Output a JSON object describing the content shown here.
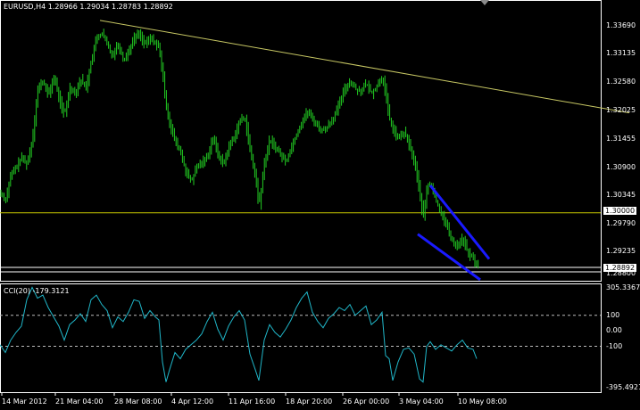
{
  "header": {
    "symbol": "EURUSD,H4",
    "open": "1.28966",
    "high": "1.29034",
    "low": "1.28783",
    "close": "1.28892"
  },
  "colors": {
    "background": "#000000",
    "candle": "#22cc22",
    "trendline": "#c8c864",
    "hline": "#c8c800",
    "wedge": "#1a1aff",
    "cci_line": "#20b6c8",
    "grid": "#ffffff"
  },
  "price_axis": {
    "ticks": [
      "1.33690",
      "1.33135",
      "1.32580",
      "1.32025",
      "1.31455",
      "1.30900",
      "1.30345",
      "1.29790",
      "1.29235",
      "1.28800"
    ],
    "tick_values": [
      1.3369,
      1.33135,
      1.3258,
      1.32025,
      1.31455,
      1.309,
      1.30345,
      1.2979,
      1.29235,
      1.288
    ],
    "hline_label": "1.30000",
    "current_label": "1.28892"
  },
  "cci": {
    "title": "CCI(20) -179.3121",
    "ticks": [
      "305.3367",
      "100",
      "0.00",
      "-100",
      "-395.4921"
    ],
    "tick_values": [
      305.3367,
      100,
      0,
      -100,
      -395.4921
    ]
  },
  "time_axis": {
    "labels": [
      "14 Mar 2012",
      "21 Mar 04:00",
      "28 Mar 08:00",
      "4 Apr 12:00",
      "11 Apr 16:00",
      "18 Apr 20:00",
      "26 Apr 00:00",
      "3 May 04:00",
      "10 May 08:00"
    ]
  },
  "chart_data": {
    "type": "line",
    "price_ylim": [
      1.2866,
      1.3388
    ],
    "cci_ylim": [
      -395.4921,
      305.3367
    ],
    "close_path": [
      [
        0,
        1.304
      ],
      [
        6,
        1.3025
      ],
      [
        12,
        1.3075
      ],
      [
        18,
        1.309
      ],
      [
        24,
        1.311
      ],
      [
        30,
        1.3095
      ],
      [
        36,
        1.3145
      ],
      [
        42,
        1.3245
      ],
      [
        48,
        1.326
      ],
      [
        54,
        1.323
      ],
      [
        60,
        1.327
      ],
      [
        66,
        1.3225
      ],
      [
        72,
        1.319
      ],
      [
        78,
        1.325
      ],
      [
        84,
        1.3235
      ],
      [
        90,
        1.3265
      ],
      [
        96,
        1.3245
      ],
      [
        102,
        1.33
      ],
      [
        108,
        1.3345
      ],
      [
        114,
        1.3355
      ],
      [
        120,
        1.333
      ],
      [
        126,
        1.331
      ],
      [
        132,
        1.3335
      ],
      [
        138,
        1.33
      ],
      [
        144,
        1.332
      ],
      [
        150,
        1.3345
      ],
      [
        156,
        1.3355
      ],
      [
        162,
        1.333
      ],
      [
        168,
        1.3345
      ],
      [
        174,
        1.3335
      ],
      [
        178,
        1.3325
      ],
      [
        182,
        1.327
      ],
      [
        186,
        1.321
      ],
      [
        190,
        1.3175
      ],
      [
        196,
        1.314
      ],
      [
        202,
        1.312
      ],
      [
        208,
        1.308
      ],
      [
        214,
        1.306
      ],
      [
        220,
        1.309
      ],
      [
        226,
        1.31
      ],
      [
        232,
        1.311
      ],
      [
        238,
        1.315
      ],
      [
        244,
        1.3115
      ],
      [
        250,
        1.3095
      ],
      [
        256,
        1.313
      ],
      [
        262,
        1.315
      ],
      [
        268,
        1.318
      ],
      [
        274,
        1.319
      ],
      [
        280,
        1.312
      ],
      [
        286,
        1.307
      ],
      [
        290,
        1.301
      ],
      [
        296,
        1.31
      ],
      [
        302,
        1.3145
      ],
      [
        308,
        1.313
      ],
      [
        314,
        1.3115
      ],
      [
        320,
        1.31
      ],
      [
        326,
        1.313
      ],
      [
        332,
        1.3155
      ],
      [
        338,
        1.318
      ],
      [
        344,
        1.32
      ],
      [
        350,
        1.3185
      ],
      [
        356,
        1.317
      ],
      [
        362,
        1.316
      ],
      [
        368,
        1.3175
      ],
      [
        374,
        1.319
      ],
      [
        380,
        1.3215
      ],
      [
        386,
        1.3245
      ],
      [
        392,
        1.326
      ],
      [
        398,
        1.3245
      ],
      [
        404,
        1.324
      ],
      [
        410,
        1.3255
      ],
      [
        416,
        1.3235
      ],
      [
        422,
        1.325
      ],
      [
        428,
        1.327
      ],
      [
        432,
        1.323
      ],
      [
        436,
        1.3185
      ],
      [
        440,
        1.3165
      ],
      [
        446,
        1.3145
      ],
      [
        452,
        1.316
      ],
      [
        458,
        1.3135
      ],
      [
        464,
        1.31
      ],
      [
        470,
        1.304
      ],
      [
        474,
        1.2985
      ],
      [
        478,
        1.305
      ],
      [
        482,
        1.306
      ],
      [
        488,
        1.3025
      ],
      [
        494,
        1.3
      ],
      [
        500,
        1.2975
      ],
      [
        506,
        1.2945
      ],
      [
        512,
        1.2935
      ],
      [
        518,
        1.295
      ],
      [
        524,
        1.292
      ],
      [
        530,
        1.291
      ],
      [
        534,
        1.2895
      ],
      [
        537,
        1.2889
      ]
    ],
    "cci_path": [
      [
        0,
        -90
      ],
      [
        6,
        -140
      ],
      [
        12,
        -60
      ],
      [
        18,
        -10
      ],
      [
        24,
        30
      ],
      [
        30,
        200
      ],
      [
        36,
        280
      ],
      [
        42,
        210
      ],
      [
        48,
        230
      ],
      [
        54,
        150
      ],
      [
        60,
        90
      ],
      [
        66,
        30
      ],
      [
        72,
        -60
      ],
      [
        78,
        40
      ],
      [
        84,
        70
      ],
      [
        90,
        110
      ],
      [
        96,
        60
      ],
      [
        102,
        200
      ],
      [
        108,
        230
      ],
      [
        114,
        170
      ],
      [
        120,
        130
      ],
      [
        126,
        20
      ],
      [
        132,
        90
      ],
      [
        138,
        60
      ],
      [
        144,
        120
      ],
      [
        150,
        200
      ],
      [
        156,
        190
      ],
      [
        162,
        80
      ],
      [
        168,
        130
      ],
      [
        174,
        90
      ],
      [
        178,
        70
      ],
      [
        182,
        -200
      ],
      [
        186,
        -330
      ],
      [
        190,
        -250
      ],
      [
        196,
        -140
      ],
      [
        202,
        -180
      ],
      [
        208,
        -120
      ],
      [
        214,
        -90
      ],
      [
        220,
        -60
      ],
      [
        226,
        -20
      ],
      [
        232,
        60
      ],
      [
        238,
        120
      ],
      [
        244,
        10
      ],
      [
        250,
        -60
      ],
      [
        256,
        30
      ],
      [
        262,
        90
      ],
      [
        268,
        130
      ],
      [
        274,
        70
      ],
      [
        280,
        -150
      ],
      [
        286,
        -250
      ],
      [
        290,
        -320
      ],
      [
        296,
        -60
      ],
      [
        302,
        40
      ],
      [
        308,
        -10
      ],
      [
        314,
        -40
      ],
      [
        320,
        10
      ],
      [
        326,
        70
      ],
      [
        332,
        150
      ],
      [
        338,
        210
      ],
      [
        344,
        250
      ],
      [
        350,
        120
      ],
      [
        356,
        60
      ],
      [
        362,
        20
      ],
      [
        368,
        80
      ],
      [
        374,
        110
      ],
      [
        380,
        150
      ],
      [
        386,
        130
      ],
      [
        392,
        170
      ],
      [
        398,
        100
      ],
      [
        404,
        130
      ],
      [
        410,
        160
      ],
      [
        416,
        40
      ],
      [
        422,
        70
      ],
      [
        428,
        120
      ],
      [
        432,
        -160
      ],
      [
        436,
        -180
      ],
      [
        440,
        -320
      ],
      [
        446,
        -200
      ],
      [
        452,
        -120
      ],
      [
        458,
        -110
      ],
      [
        464,
        -150
      ],
      [
        470,
        -310
      ],
      [
        474,
        -330
      ],
      [
        478,
        -100
      ],
      [
        482,
        -70
      ],
      [
        488,
        -120
      ],
      [
        494,
        -90
      ],
      [
        500,
        -110
      ],
      [
        506,
        -130
      ],
      [
        512,
        -90
      ],
      [
        518,
        -60
      ],
      [
        524,
        -110
      ],
      [
        530,
        -120
      ],
      [
        534,
        -180
      ]
    ],
    "trendline": [
      [
        112,
        1.33795
      ],
      [
        705,
        1.3197
      ]
    ],
    "hline": 1.3,
    "wedge_upper": [
      [
        482,
        1.3054
      ],
      [
        548,
        1.2909
      ]
    ],
    "wedge_lower": [
      [
        468,
        1.2958
      ],
      [
        538,
        1.2868
      ]
    ]
  }
}
